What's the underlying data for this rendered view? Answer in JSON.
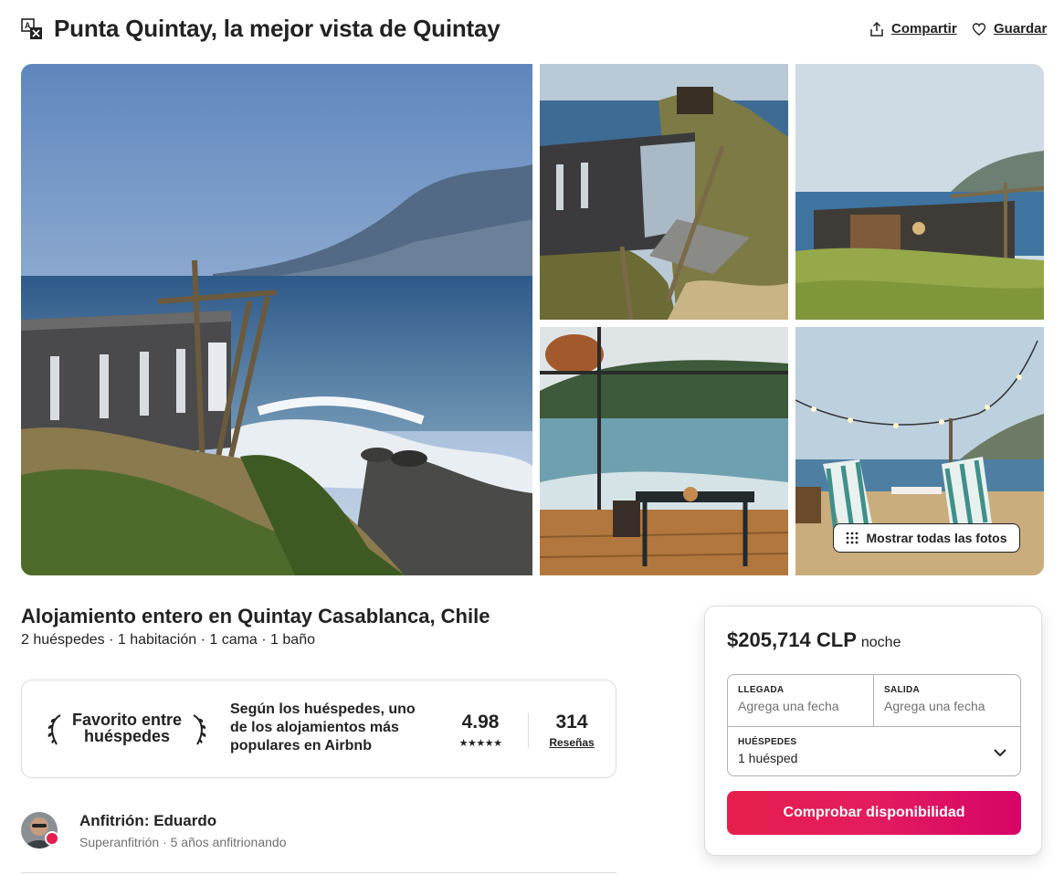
{
  "header": {
    "title": "Punta Quintay, la mejor vista de Quintay",
    "share_label": "Compartir",
    "save_label": "Guardar"
  },
  "gallery": {
    "show_all_label": "Mostrar todas las fotos"
  },
  "listing": {
    "heading": "Alojamiento entero en Quintay Casablanca, Chile",
    "specs": "2 huéspedes · 1 habitación · 1 cama · 1 baño"
  },
  "guest_favorite": {
    "label": "Favorito entre huéspedes",
    "description": "Según los huéspedes, uno de los alojamientos más populares en Airbnb",
    "rating": "4.98",
    "stars": 5,
    "reviews_count": "314",
    "reviews_label": "Reseñas"
  },
  "host": {
    "name": "Anfitrión: Eduardo",
    "subtitle": "Superanfitrión · 5 años anfitrionando"
  },
  "booking": {
    "price": "$205,714 CLP",
    "per": "noche",
    "checkin_label": "LLEGADA",
    "checkin_placeholder": "Agrega una fecha",
    "checkout_label": "SALIDA",
    "checkout_placeholder": "Agrega una fecha",
    "guests_label": "HUÉSPEDES",
    "guests_value": "1 huésped",
    "cta_label": "Comprobar disponibilidad"
  },
  "colors": {
    "accent": "#e61e4d",
    "text": "#222222",
    "muted": "#717171",
    "border": "#dddddd"
  }
}
